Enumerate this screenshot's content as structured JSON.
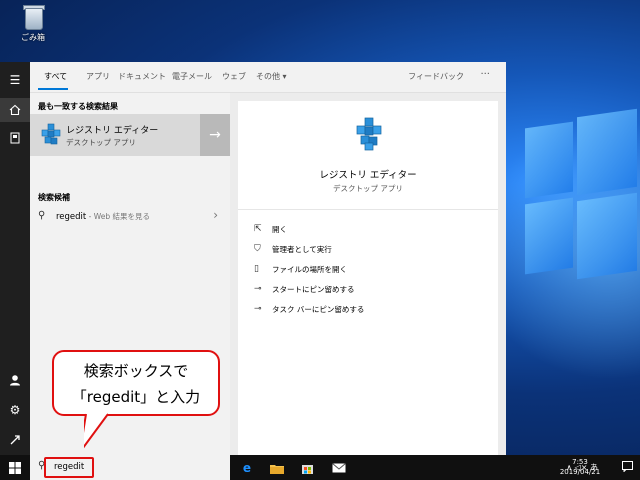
{
  "desktop": {
    "recycle_bin_label": "ごみ箱"
  },
  "rail": {
    "items": [
      "hamburger-icon",
      "home-icon",
      "document-icon",
      "user-icon",
      "gear-icon",
      "power-icon"
    ]
  },
  "search": {
    "tabs": [
      {
        "label": "すべて",
        "active": true
      },
      {
        "label": "アプリ"
      },
      {
        "label": "ドキュメント"
      },
      {
        "label": "電子メール"
      },
      {
        "label": "ウェブ"
      },
      {
        "label": "その他 ▾"
      }
    ],
    "feedback_label": "フィードバック",
    "more_label": "···",
    "best_match_header": "最も一致する検索結果",
    "best_match": {
      "title": "レジストリ エディター",
      "subtitle": "デスクトップ アプリ"
    },
    "suggestions_header": "検索候補",
    "suggestion": {
      "query": "regedit",
      "suffix": " - Web 結果を見る"
    },
    "detail": {
      "title": "レジストリ エディター",
      "subtitle": "デスクトップ アプリ",
      "actions": [
        {
          "icon": "open-icon",
          "label": "開く"
        },
        {
          "icon": "shield-icon",
          "label": "管理者として実行"
        },
        {
          "icon": "file-location-icon",
          "label": "ファイルの場所を開く"
        },
        {
          "icon": "pin-icon",
          "label": "スタートにピン留めする"
        },
        {
          "icon": "pin-icon",
          "label": "タスク バーにピン留めする"
        }
      ]
    }
  },
  "taskbar": {
    "search_value": "regedit",
    "clock_time": "7:53",
    "clock_date": "2019/04/21",
    "tray_symbols": "∧ ◁× あ"
  },
  "annotation": {
    "line1": "検索ボックスで",
    "line2": "「regedit」と入力"
  },
  "colors": {
    "accent": "#0078d7",
    "annotation": "#e01010"
  }
}
